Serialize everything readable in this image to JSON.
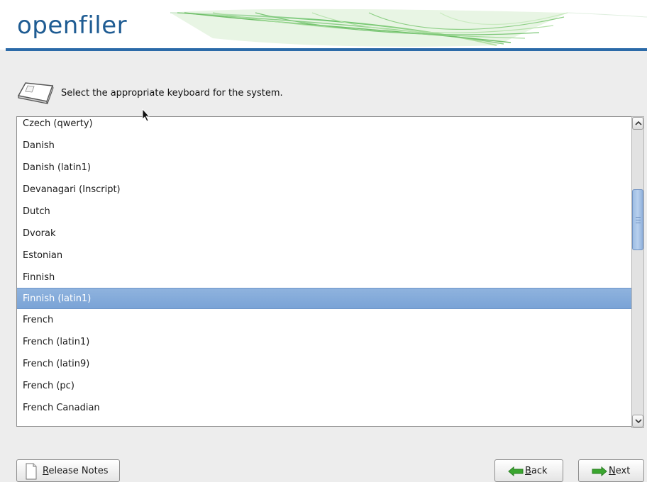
{
  "header": {
    "brand": "openfiler"
  },
  "instruction": {
    "text": "Select the appropriate keyboard for the system."
  },
  "keyboard_list": {
    "items": [
      "Czech (qwerty)",
      "Danish",
      "Danish (latin1)",
      "Devanagari (Inscript)",
      "Dutch",
      "Dvorak",
      "Estonian",
      "Finnish",
      "Finnish (latin1)",
      "French",
      "French (latin1)",
      "French (latin9)",
      "French (pc)",
      "French Canadian"
    ],
    "selected": "Finnish (latin1)"
  },
  "buttons": {
    "release_notes": {
      "accel": "R",
      "rest": "elease Notes"
    },
    "back": {
      "accel": "B",
      "rest": "ack"
    },
    "next": {
      "accel": "N",
      "rest": "ext"
    }
  },
  "icons": {
    "keyboard": "keyboard-icon",
    "document": "document-icon",
    "back_arrow": "arrow-left-icon",
    "next_arrow": "arrow-right-icon",
    "scroll_up": "chevron-up-icon",
    "scroll_down": "chevron-down-icon"
  },
  "colors": {
    "brand": "#1f5c93",
    "selection": "#7aa3d6",
    "arrow_green": "#3aa62f"
  }
}
